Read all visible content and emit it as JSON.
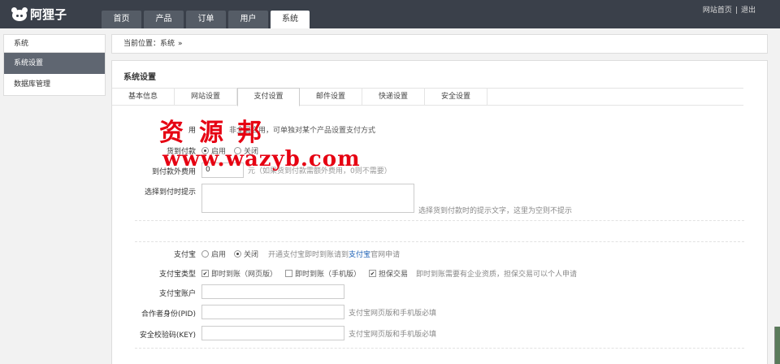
{
  "header": {
    "logo_text": "阿狸子",
    "nav_tabs": [
      {
        "label": "首页",
        "active": false
      },
      {
        "label": "产品",
        "active": false
      },
      {
        "label": "订单",
        "active": false
      },
      {
        "label": "用户",
        "active": false
      },
      {
        "label": "系统",
        "active": true
      }
    ],
    "links": {
      "home": "网站首页",
      "separator": "|",
      "logout": "退出"
    }
  },
  "sidebar": {
    "section_title": "系统",
    "items": [
      {
        "label": "系统设置",
        "active": true
      },
      {
        "label": "数据库管理",
        "active": false
      }
    ]
  },
  "breadcrumb": {
    "prefix": "当前位置：",
    "current": "系统",
    "chevron": "»"
  },
  "panel": {
    "title": "系统设置",
    "tabs": [
      {
        "label": "基本信息",
        "active": false
      },
      {
        "label": "网站设置",
        "active": false
      },
      {
        "label": "支付设置",
        "active": true
      },
      {
        "label": "邮件设置",
        "active": false
      },
      {
        "label": "快递设置",
        "active": false
      },
      {
        "label": "安全设置",
        "active": false
      }
    ]
  },
  "form": {
    "row0": {
      "label_fragment": "用",
      "hint": "非全局启用，可单独对某个产品设置支付方式"
    },
    "cod": {
      "label": "货到付款",
      "opt_on": "启用",
      "opt_off": "关闭",
      "selected": "启用"
    },
    "cod_fee": {
      "label": "到付款外费用",
      "value": "0",
      "hint": "元（如果货到付款需额外费用，0则不需要）"
    },
    "cod_tip": {
      "label": "选择到付时提示",
      "value": "",
      "hint": "选择货到付款时的提示文字，这里为空则不提示"
    },
    "alipay": {
      "label": "支付宝",
      "opt_on": "启用",
      "opt_off": "关闭",
      "selected": "关闭",
      "hint_pre": "开通支付宝即时到账请到",
      "hint_link": "支付宝",
      "hint_post": "官网申请"
    },
    "alipay_type": {
      "label": "支付宝类型",
      "options": [
        {
          "label": "即时到账（网页版）",
          "checked": true
        },
        {
          "label": "即时到账（手机版）",
          "checked": false
        },
        {
          "label": "担保交易",
          "checked": true
        }
      ],
      "hint": "即时到账需要有企业资质，担保交易可以个人申请"
    },
    "alipay_account": {
      "label": "支付宝账户",
      "value": ""
    },
    "partner_id": {
      "label": "合作者身份(PID)",
      "value": "",
      "hint": "支付宝网页版和手机版必填"
    },
    "security_key": {
      "label": "安全校验码(KEY)",
      "value": "",
      "hint": "支付宝网页版和手机版必填"
    }
  },
  "watermark": {
    "chars": [
      "资",
      "源",
      "邦"
    ],
    "url": "www.wazyb.com",
    "color": "#e60012"
  }
}
